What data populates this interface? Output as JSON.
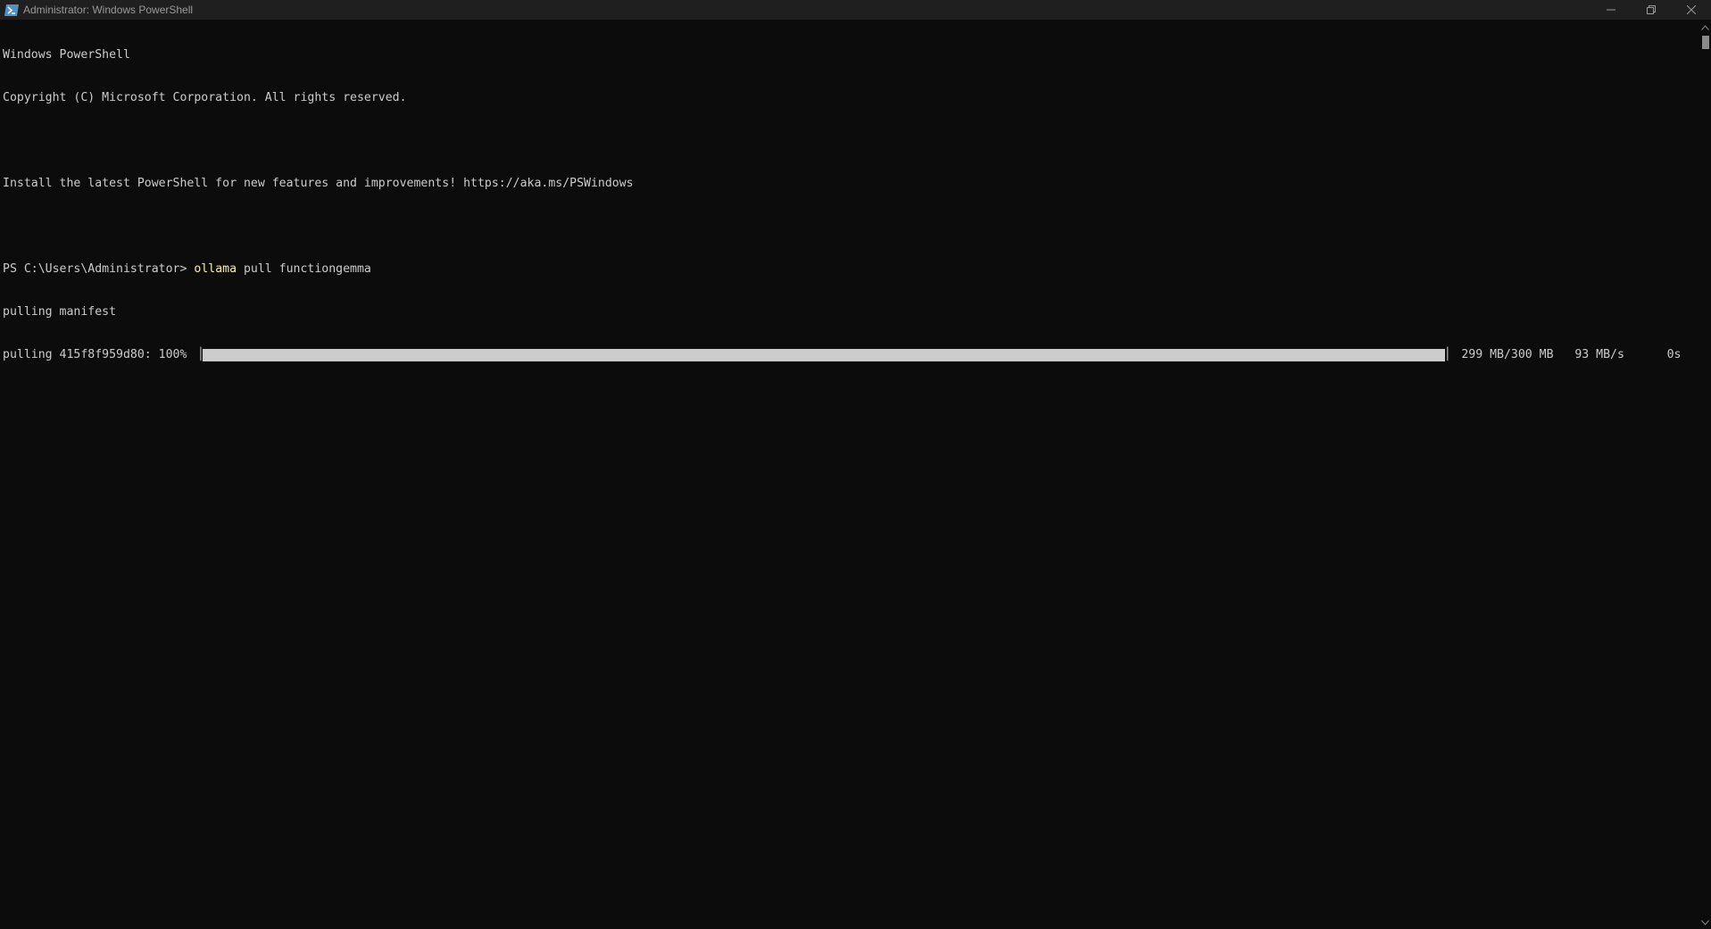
{
  "window": {
    "title": "Administrator: Windows PowerShell",
    "controls": [
      "minimize-icon",
      "restore-icon",
      "close-icon"
    ],
    "app_icon": "powershell-icon"
  },
  "colors": {
    "background": "#0c0c0c",
    "foreground": "#cccccc",
    "command_highlight": "#f9f1a5",
    "titlebar": "#1f1f1f"
  },
  "terminal": {
    "lines": [
      "Windows PowerShell",
      "Copyright (C) Microsoft Corporation. All rights reserved.",
      "",
      "Install the latest PowerShell for new features and improvements! https://aka.ms/PSWindows",
      ""
    ],
    "prompt": {
      "path": "PS C:\\Users\\Administrator> ",
      "command": "ollama",
      "args": " pull functiongemma"
    },
    "status_line": "pulling manifest",
    "progress": {
      "label": "pulling 415f8f959d80: 100% ",
      "left_glyph": "▕",
      "right_glyph": "▏",
      "fraction": 1.0,
      "size": " 299 MB/300 MB",
      "speed": "   93 MB/s",
      "eta": "      0s"
    }
  }
}
